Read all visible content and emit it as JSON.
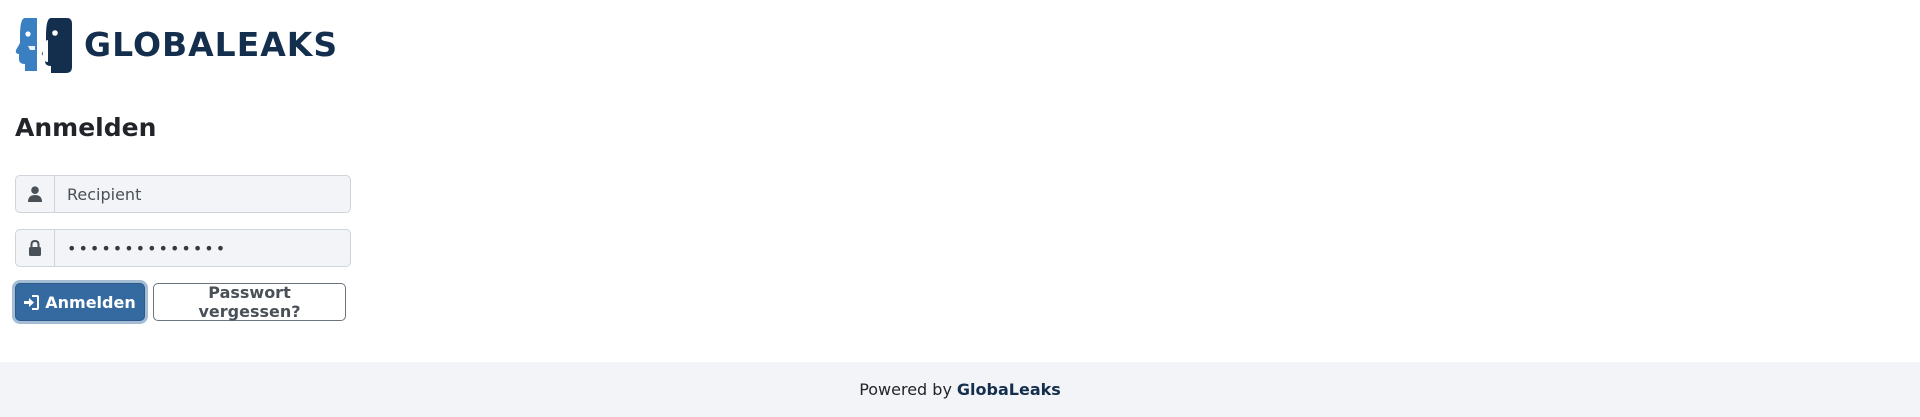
{
  "header": {
    "logo_text": "GLOBALEAKS",
    "logo_icon": "globaleaks-faces-icon"
  },
  "login": {
    "title": "Anmelden",
    "username": {
      "icon": "user-icon",
      "value": "Recipient"
    },
    "password": {
      "icon": "lock-icon",
      "value": "••••••••••••••"
    },
    "login_button": {
      "icon": "sign-in-icon",
      "label": "Anmelden"
    },
    "forgot_button": {
      "label": "Passwort vergessen?"
    }
  },
  "footer": {
    "prefix": "Powered by",
    "brand": "GlobaLeaks"
  },
  "colors": {
    "brand_dark": "#142f4d",
    "brand_light": "#3a7fc1",
    "primary": "#356aa0",
    "footer_bg": "#f3f4f7"
  }
}
